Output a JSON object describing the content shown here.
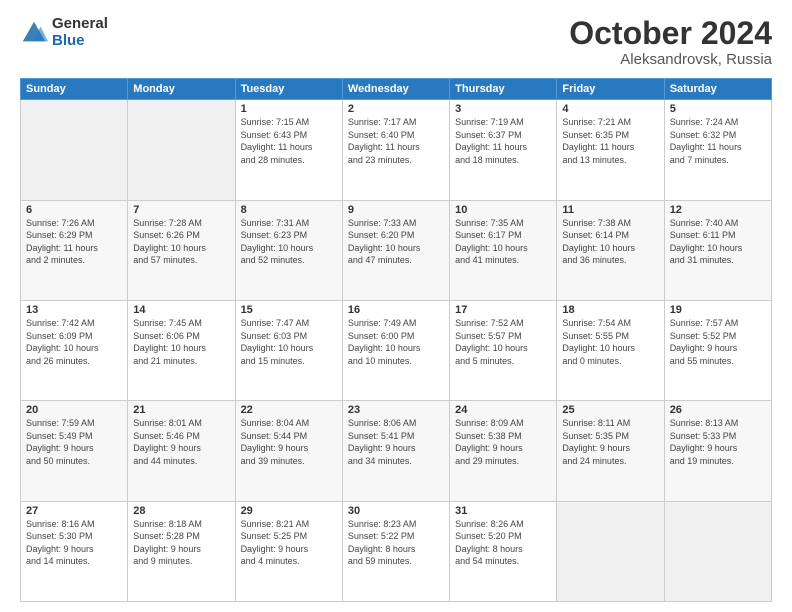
{
  "logo": {
    "general": "General",
    "blue": "Blue"
  },
  "title": "October 2024",
  "location": "Aleksandrovsk, Russia",
  "days_of_week": [
    "Sunday",
    "Monday",
    "Tuesday",
    "Wednesday",
    "Thursday",
    "Friday",
    "Saturday"
  ],
  "weeks": [
    [
      {
        "day": "",
        "info": ""
      },
      {
        "day": "",
        "info": ""
      },
      {
        "day": "1",
        "info": "Sunrise: 7:15 AM\nSunset: 6:43 PM\nDaylight: 11 hours\nand 28 minutes."
      },
      {
        "day": "2",
        "info": "Sunrise: 7:17 AM\nSunset: 6:40 PM\nDaylight: 11 hours\nand 23 minutes."
      },
      {
        "day": "3",
        "info": "Sunrise: 7:19 AM\nSunset: 6:37 PM\nDaylight: 11 hours\nand 18 minutes."
      },
      {
        "day": "4",
        "info": "Sunrise: 7:21 AM\nSunset: 6:35 PM\nDaylight: 11 hours\nand 13 minutes."
      },
      {
        "day": "5",
        "info": "Sunrise: 7:24 AM\nSunset: 6:32 PM\nDaylight: 11 hours\nand 7 minutes."
      }
    ],
    [
      {
        "day": "6",
        "info": "Sunrise: 7:26 AM\nSunset: 6:29 PM\nDaylight: 11 hours\nand 2 minutes."
      },
      {
        "day": "7",
        "info": "Sunrise: 7:28 AM\nSunset: 6:26 PM\nDaylight: 10 hours\nand 57 minutes."
      },
      {
        "day": "8",
        "info": "Sunrise: 7:31 AM\nSunset: 6:23 PM\nDaylight: 10 hours\nand 52 minutes."
      },
      {
        "day": "9",
        "info": "Sunrise: 7:33 AM\nSunset: 6:20 PM\nDaylight: 10 hours\nand 47 minutes."
      },
      {
        "day": "10",
        "info": "Sunrise: 7:35 AM\nSunset: 6:17 PM\nDaylight: 10 hours\nand 41 minutes."
      },
      {
        "day": "11",
        "info": "Sunrise: 7:38 AM\nSunset: 6:14 PM\nDaylight: 10 hours\nand 36 minutes."
      },
      {
        "day": "12",
        "info": "Sunrise: 7:40 AM\nSunset: 6:11 PM\nDaylight: 10 hours\nand 31 minutes."
      }
    ],
    [
      {
        "day": "13",
        "info": "Sunrise: 7:42 AM\nSunset: 6:09 PM\nDaylight: 10 hours\nand 26 minutes."
      },
      {
        "day": "14",
        "info": "Sunrise: 7:45 AM\nSunset: 6:06 PM\nDaylight: 10 hours\nand 21 minutes."
      },
      {
        "day": "15",
        "info": "Sunrise: 7:47 AM\nSunset: 6:03 PM\nDaylight: 10 hours\nand 15 minutes."
      },
      {
        "day": "16",
        "info": "Sunrise: 7:49 AM\nSunset: 6:00 PM\nDaylight: 10 hours\nand 10 minutes."
      },
      {
        "day": "17",
        "info": "Sunrise: 7:52 AM\nSunset: 5:57 PM\nDaylight: 10 hours\nand 5 minutes."
      },
      {
        "day": "18",
        "info": "Sunrise: 7:54 AM\nSunset: 5:55 PM\nDaylight: 10 hours\nand 0 minutes."
      },
      {
        "day": "19",
        "info": "Sunrise: 7:57 AM\nSunset: 5:52 PM\nDaylight: 9 hours\nand 55 minutes."
      }
    ],
    [
      {
        "day": "20",
        "info": "Sunrise: 7:59 AM\nSunset: 5:49 PM\nDaylight: 9 hours\nand 50 minutes."
      },
      {
        "day": "21",
        "info": "Sunrise: 8:01 AM\nSunset: 5:46 PM\nDaylight: 9 hours\nand 44 minutes."
      },
      {
        "day": "22",
        "info": "Sunrise: 8:04 AM\nSunset: 5:44 PM\nDaylight: 9 hours\nand 39 minutes."
      },
      {
        "day": "23",
        "info": "Sunrise: 8:06 AM\nSunset: 5:41 PM\nDaylight: 9 hours\nand 34 minutes."
      },
      {
        "day": "24",
        "info": "Sunrise: 8:09 AM\nSunset: 5:38 PM\nDaylight: 9 hours\nand 29 minutes."
      },
      {
        "day": "25",
        "info": "Sunrise: 8:11 AM\nSunset: 5:35 PM\nDaylight: 9 hours\nand 24 minutes."
      },
      {
        "day": "26",
        "info": "Sunrise: 8:13 AM\nSunset: 5:33 PM\nDaylight: 9 hours\nand 19 minutes."
      }
    ],
    [
      {
        "day": "27",
        "info": "Sunrise: 8:16 AM\nSunset: 5:30 PM\nDaylight: 9 hours\nand 14 minutes."
      },
      {
        "day": "28",
        "info": "Sunrise: 8:18 AM\nSunset: 5:28 PM\nDaylight: 9 hours\nand 9 minutes."
      },
      {
        "day": "29",
        "info": "Sunrise: 8:21 AM\nSunset: 5:25 PM\nDaylight: 9 hours\nand 4 minutes."
      },
      {
        "day": "30",
        "info": "Sunrise: 8:23 AM\nSunset: 5:22 PM\nDaylight: 8 hours\nand 59 minutes."
      },
      {
        "day": "31",
        "info": "Sunrise: 8:26 AM\nSunset: 5:20 PM\nDaylight: 8 hours\nand 54 minutes."
      },
      {
        "day": "",
        "info": ""
      },
      {
        "day": "",
        "info": ""
      }
    ]
  ]
}
